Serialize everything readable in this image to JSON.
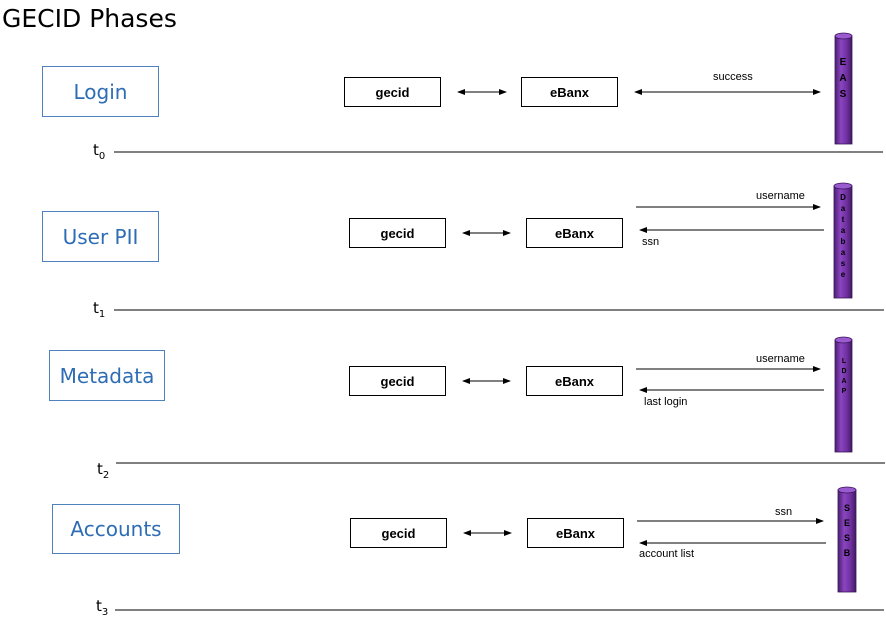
{
  "title": "GECID Phases",
  "phases": [
    {
      "label": "Login",
      "client": "gecid",
      "server": "eBanx",
      "messages": [
        {
          "text": "success",
          "direction": "both"
        }
      ],
      "system": "EAS",
      "time": "t",
      "time_sub": "0"
    },
    {
      "label": "User PII",
      "client": "gecid",
      "server": "eBanx",
      "messages": [
        {
          "text": "username",
          "direction": "to-system"
        },
        {
          "text": "ssn",
          "direction": "from-system"
        }
      ],
      "system": "Database",
      "time": "t",
      "time_sub": "1"
    },
    {
      "label": "Metadata",
      "client": "gecid",
      "server": "eBanx",
      "messages": [
        {
          "text": "username",
          "direction": "to-system"
        },
        {
          "text": "last login",
          "direction": "from-system"
        }
      ],
      "system": "LDAP",
      "time": "t",
      "time_sub": "2"
    },
    {
      "label": "Accounts",
      "client": "gecid",
      "server": "eBanx",
      "messages": [
        {
          "text": "ssn",
          "direction": "to-system"
        },
        {
          "text": "account list",
          "direction": "from-system"
        }
      ],
      "system": "SESB",
      "time": "t",
      "time_sub": "3"
    }
  ],
  "colors": {
    "cylinder": "#7030a0",
    "label_border": "#4f81bd",
    "label_text": "#2e6db4"
  }
}
